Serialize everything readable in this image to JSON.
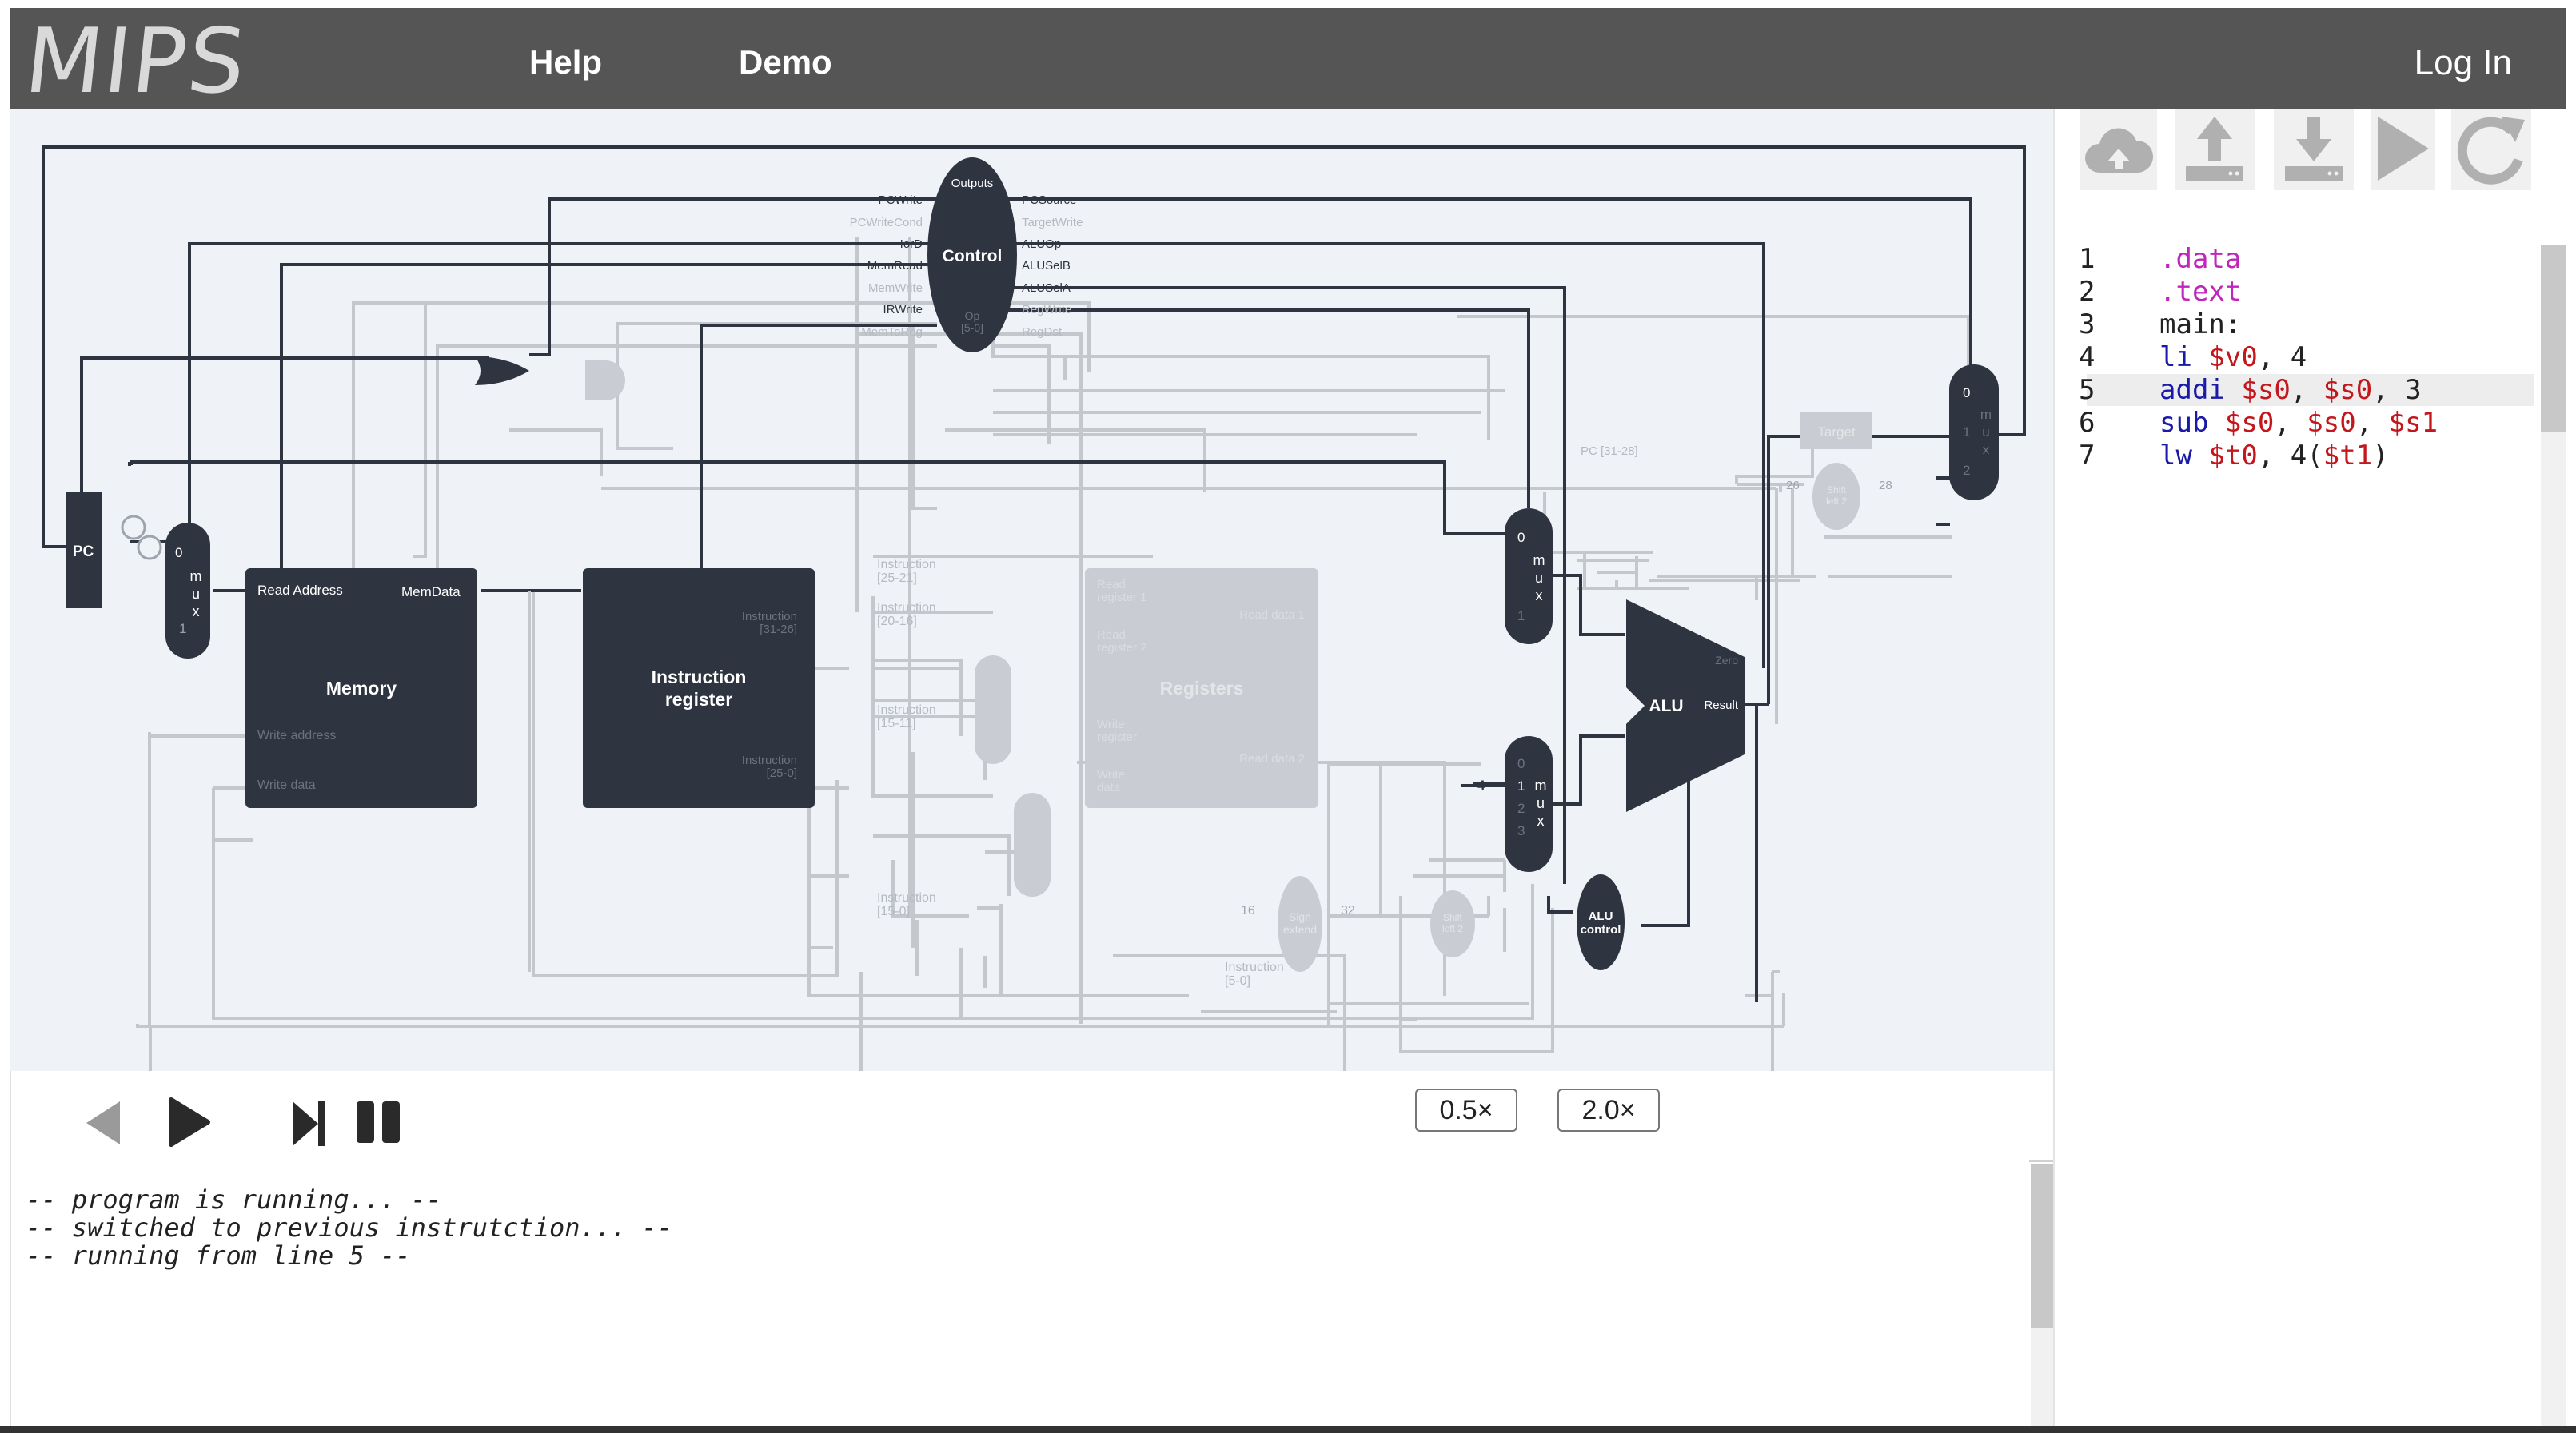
{
  "header": {
    "logo": "MIPS",
    "nav": [
      {
        "label": "Help"
      },
      {
        "label": "Demo"
      }
    ],
    "login": "Log In"
  },
  "diagram": {
    "components": {
      "pc": "PC",
      "memory": "Memory",
      "instruction_register": [
        "Instruction",
        "register"
      ],
      "registers": "Registers",
      "control": "Control",
      "control_outputs": "Outputs",
      "alu": "ALU",
      "alu_control": [
        "ALU",
        "control"
      ],
      "sign_extend": [
        "Sign",
        "extend"
      ],
      "shift_left": [
        "Shift",
        "left 2"
      ],
      "target": "Target"
    },
    "signals_left": [
      "PCWrite",
      "PCWriteCond",
      "IorD",
      "MemRead",
      "MemWrite",
      "IRWrite",
      "MemToReg"
    ],
    "signals_right": [
      "PCSource",
      "TargetWrite",
      "ALUOp",
      "ALUSelB",
      "ALUSelA",
      "RegWrite",
      "RegDst"
    ],
    "control_op": [
      "Op",
      "[5-0]"
    ],
    "memory_ports": {
      "read_address": "Read Address",
      "mem_data": "MemData",
      "write_address": "Write address",
      "write_data": "Write data"
    },
    "ir_ports": [
      "Instruction",
      "[31-26]",
      "Instruction",
      "[25-0]"
    ],
    "instruction_fields": [
      "Instruction",
      "[25-21]",
      "Instruction",
      "[20-16]",
      "Instruction",
      "[15-11]",
      "Instruction",
      "[15-0]",
      "Instruction",
      "[5-0]"
    ],
    "register_ports": [
      "Read",
      "register 1",
      "Read",
      "register 2",
      "Write",
      "register",
      "Write",
      "data",
      "Read data 1",
      "Read data 2"
    ],
    "mux_labels": {
      "zero": "0",
      "one": "1",
      "two": "2",
      "three": "3",
      "m": "m",
      "u": "u",
      "x": "x"
    },
    "alu_ports": {
      "zero": "Zero",
      "result": "Result"
    },
    "constants": {
      "four": "4",
      "sixteen": "16",
      "thirtytwo": "32",
      "pc_bits": "PC [31-28]",
      "twentysix": "26",
      "twentyeight": "28"
    }
  },
  "controls": {
    "speed_buttons": [
      "0.5×",
      "2.0×"
    ]
  },
  "console": {
    "lines": [
      "-- program is running... --",
      "-- switched to previous instrutction... --",
      "-- running from line 5 --"
    ]
  },
  "editor": {
    "lines": [
      {
        "n": "1",
        "tokens": [
          {
            "t": ".data",
            "c": "kw-dir"
          }
        ]
      },
      {
        "n": "2",
        "tokens": [
          {
            "t": ".text",
            "c": "kw-dir"
          }
        ]
      },
      {
        "n": "3",
        "tokens": [
          {
            "t": "main:",
            "c": "kw-plain"
          }
        ]
      },
      {
        "n": "4",
        "tokens": [
          {
            "t": "li",
            "c": "kw-op"
          },
          {
            "t": " ",
            "c": "kw-plain"
          },
          {
            "t": "$v0",
            "c": "kw-reg"
          },
          {
            "t": ", 4",
            "c": "kw-plain"
          }
        ]
      },
      {
        "n": "5",
        "tokens": [
          {
            "t": "addi",
            "c": "kw-op"
          },
          {
            "t": " ",
            "c": "kw-plain"
          },
          {
            "t": "$s0",
            "c": "kw-reg"
          },
          {
            "t": ", ",
            "c": "kw-plain"
          },
          {
            "t": "$s0",
            "c": "kw-reg"
          },
          {
            "t": ", 3",
            "c": "kw-plain"
          }
        ]
      },
      {
        "n": "6",
        "tokens": [
          {
            "t": "sub",
            "c": "kw-op"
          },
          {
            "t": " ",
            "c": "kw-plain"
          },
          {
            "t": "$s0",
            "c": "kw-reg"
          },
          {
            "t": ", ",
            "c": "kw-plain"
          },
          {
            "t": "$s0",
            "c": "kw-reg"
          },
          {
            "t": ", ",
            "c": "kw-plain"
          },
          {
            "t": "$s1",
            "c": "kw-reg"
          }
        ]
      },
      {
        "n": "7",
        "tokens": [
          {
            "t": "lw",
            "c": "kw-op"
          },
          {
            "t": " ",
            "c": "kw-plain"
          },
          {
            "t": "$t0",
            "c": "kw-reg"
          },
          {
            "t": ", 4(",
            "c": "kw-plain"
          },
          {
            "t": "$t1",
            "c": "kw-reg"
          },
          {
            "t": ")",
            "c": "kw-plain"
          }
        ]
      }
    ],
    "active_line": "5"
  },
  "toolbar": {
    "icons": [
      "cloud-upload-icon",
      "upload-icon",
      "download-icon",
      "play-icon",
      "redo-icon"
    ]
  },
  "colors": {
    "active": "#2e3440",
    "inactive": "#c9ccd2",
    "wire_inactive": "#c4c7cc",
    "panel_bg": "#eff2f7",
    "header_bg": "#555555"
  }
}
